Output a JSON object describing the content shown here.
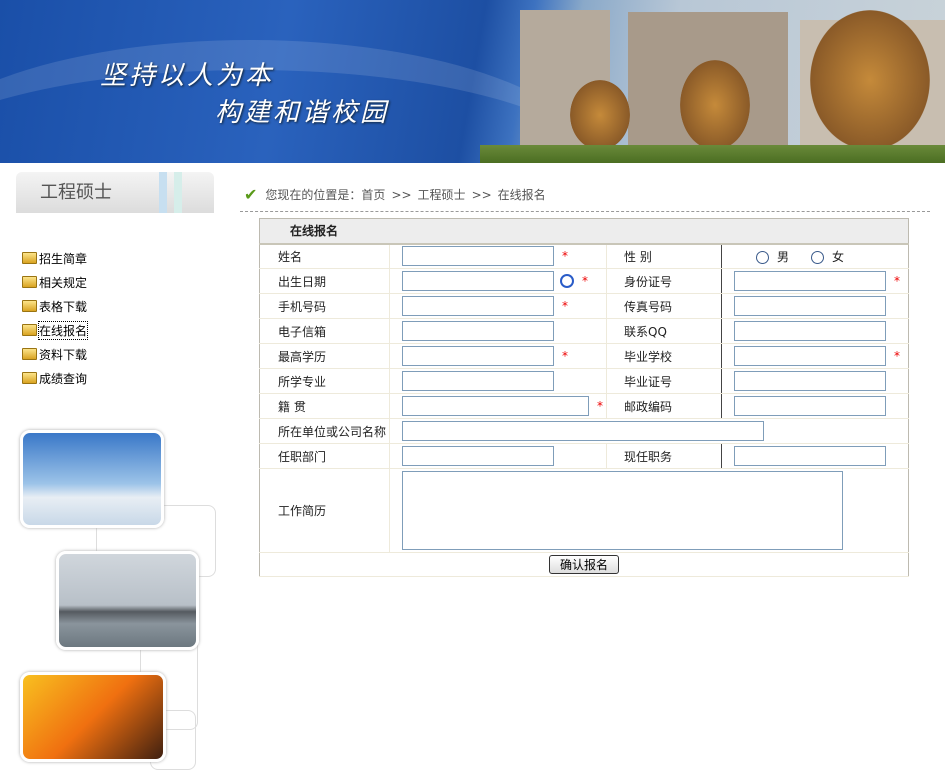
{
  "banner": {
    "line1": "坚持以人为本",
    "line2": "构建和谐校园"
  },
  "sidebar": {
    "title": "工程硕士",
    "items": [
      {
        "label": "招生简章"
      },
      {
        "label": "相关规定"
      },
      {
        "label": "表格下载"
      },
      {
        "label": "在线报名"
      },
      {
        "label": "资料下载"
      },
      {
        "label": "成绩查询"
      }
    ]
  },
  "breadcrumb": {
    "prefix": "您现在的位置是：",
    "home": "首页",
    "sep": ">>",
    "level1": "工程硕士",
    "level2": "在线报名"
  },
  "form": {
    "title": "在线报名",
    "required_mark": "*",
    "name": "姓名",
    "gender": "性 别",
    "male": "男",
    "female": "女",
    "birth": "出生日期",
    "idcard": "身份证号",
    "mobile": "手机号码",
    "fax": "传真号码",
    "email": "电子信箱",
    "qq": "联系QQ",
    "education": "最高学历",
    "school": "毕业学校",
    "major": "所学专业",
    "diploma": "毕业证号",
    "native": "籍 贯",
    "postcode": "邮政编码",
    "company": "所在单位或公司名称",
    "department": "任职部门",
    "position": "现任职务",
    "resume": "工作简历",
    "submit": "确认报名"
  }
}
